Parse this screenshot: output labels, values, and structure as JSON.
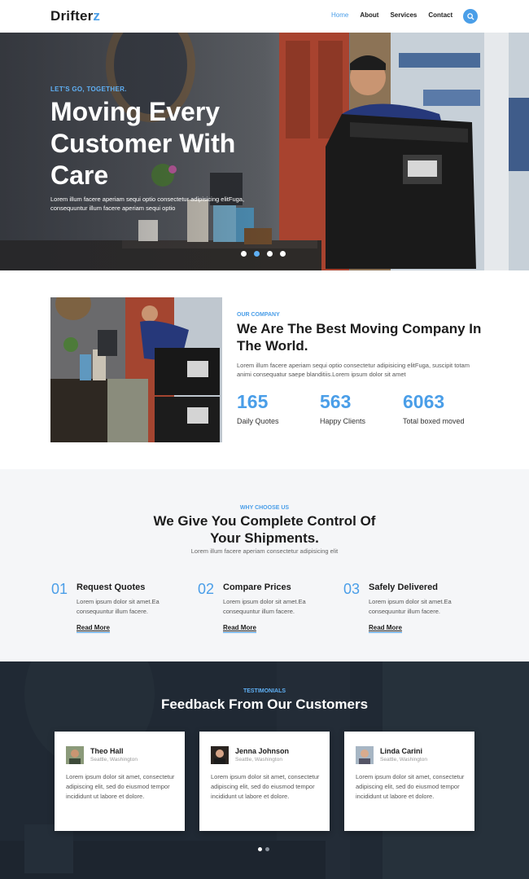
{
  "nav": {
    "logo_main": "Drifter",
    "logo_accent": "z",
    "items": [
      {
        "label": "Home",
        "active": true
      },
      {
        "label": "About",
        "active": false
      },
      {
        "label": "Services",
        "active": false
      },
      {
        "label": "Contact",
        "active": false
      }
    ],
    "search_icon": "search-icon"
  },
  "hero": {
    "tagline": "LET'S GO, TOGETHER.",
    "title": "Moving Every Customer With Care",
    "text": "Lorem illum facere aperiam sequi optio consectetur adipisicing elitFuga, consequuntur illum facere aperiam sequi optio",
    "slides": 4,
    "active_slide": 2
  },
  "about": {
    "tag": "OUR COMPANY",
    "title": "We Are The Best Moving Company In The World.",
    "text": "Lorem illum facere aperiam sequi optio consectetur adipisicing elitFuga, suscipit totam animi consequatur saepe blanditiis.Lorem ipsum dolor sit amet",
    "stats": [
      {
        "value": "165",
        "label": "Daily Quotes"
      },
      {
        "value": "563",
        "label": "Happy Clients"
      },
      {
        "value": "6063",
        "label": "Total boxed moved"
      }
    ]
  },
  "why": {
    "tag": "WHY CHOOSE US",
    "title": "We Give You Complete Control Of Your Shipments.",
    "subtitle": "Lorem illum facere aperiam consectetur adipisicing elit",
    "features": [
      {
        "num": "01",
        "title": "Request Quotes",
        "text": "Lorem ipsum dolor sit amet.Ea consequuntur illum facere.",
        "link": "Read More"
      },
      {
        "num": "02",
        "title": "Compare Prices",
        "text": "Lorem ipsum dolor sit amet.Ea consequuntur illum facere.",
        "link": "Read More"
      },
      {
        "num": "03",
        "title": "Safely Delivered",
        "text": "Lorem ipsum dolor sit amet.Ea consequuntur illum facere.",
        "link": "Read More"
      }
    ]
  },
  "testimonials": {
    "tag": "TESTIMONIALS",
    "title": "Feedback From Our Customers",
    "items": [
      {
        "name": "Theo Hall",
        "location": "Seattle, Washington",
        "text": "Lorem ipsum dolor sit amet, consectetur adipiscing elit, sed do eiusmod tempor incididunt ut labore et dolore."
      },
      {
        "name": "Jenna Johnson",
        "location": "Seattle, Washington",
        "text": "Lorem ipsum dolor sit amet, consectetur adipiscing elit, sed do eiusmod tempor incididunt ut labore et dolore."
      },
      {
        "name": "Linda Carini",
        "location": "Seattle, Washington",
        "text": "Lorem ipsum dolor sit amet, consectetur adipiscing elit, sed do eiusmod tempor incididunt ut labore et dolore."
      }
    ],
    "pages": 2,
    "active_page": 1
  },
  "colors": {
    "accent": "#4a9ee8",
    "dark": "#1c1c1c",
    "testimonial_bg": "#27313d"
  }
}
